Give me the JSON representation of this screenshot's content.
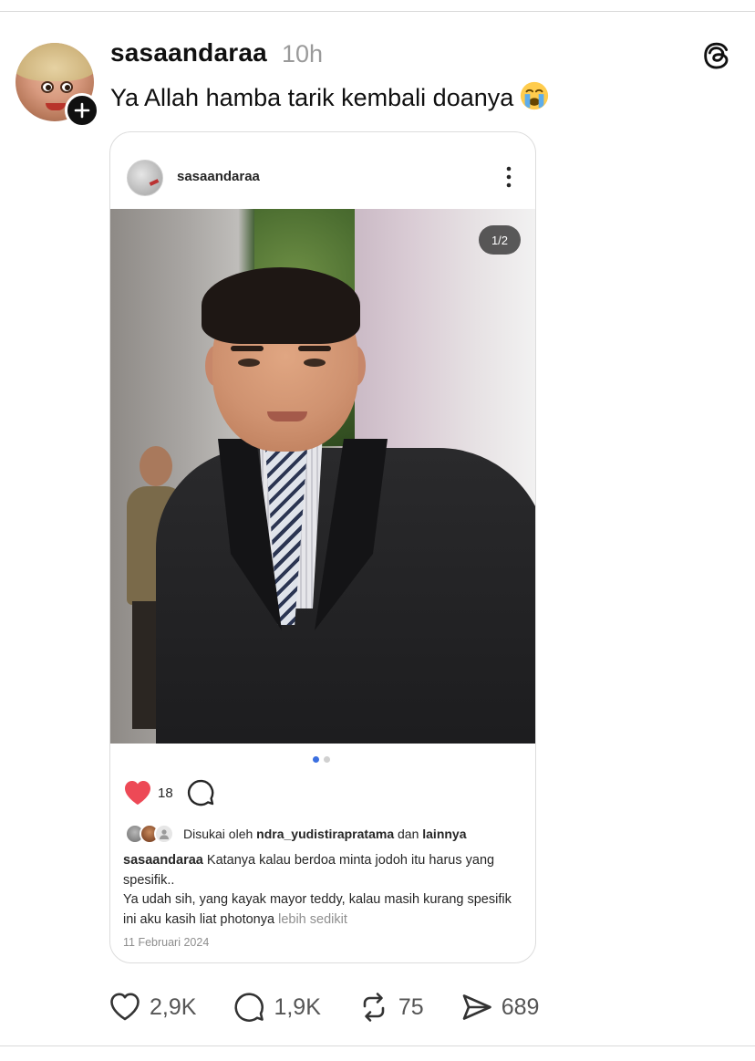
{
  "post": {
    "username": "sasaandaraa",
    "time": "10h",
    "text": "Ya Allah hamba tarik kembali doanya",
    "emoji": "loudly-crying-face"
  },
  "embed": {
    "username": "sasaandaraa",
    "page_indicator": "1/2",
    "likes": "18",
    "liked_by_prefix": "Disukai oleh",
    "liked_by_user": "ndra_yudistirapratama",
    "liked_by_joiner": "dan",
    "liked_by_others": "lainnya",
    "caption_user": "sasaandaraa",
    "caption_line1": "Katanya kalau berdoa minta jodoh itu harus yang spesifik..",
    "caption_line2": "Ya udah sih, yang kayak mayor teddy, kalau masih kurang spesifik ini aku kasih liat photonya",
    "more_label": "lebih sedikit",
    "date": "11 Februari 2024",
    "carousel_position": 1,
    "carousel_total": 2
  },
  "footer": {
    "likes": "2,9K",
    "comments": "1,9K",
    "reposts": "75",
    "shares": "689"
  },
  "colors": {
    "heart": "#ed4956",
    "active_dot": "#3b6fe0",
    "muted": "#9a9a9a"
  }
}
